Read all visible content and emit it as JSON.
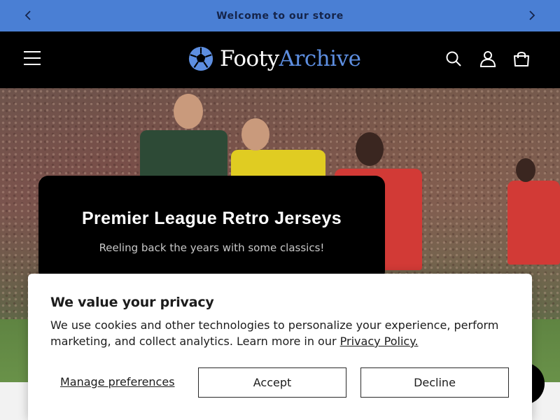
{
  "announcement": {
    "text": "Welcome to our store",
    "prev_icon": "chevron-left-icon",
    "next_icon": "chevron-right-icon",
    "background": "#4a7fd4"
  },
  "header": {
    "logo_primary": "Footy",
    "logo_accent": "Archive",
    "accent_color": "#5d8ee0",
    "icons": [
      "menu-icon",
      "search-icon",
      "account-icon",
      "cart-icon"
    ]
  },
  "hero": {
    "title": "Premier League Retro Jerseys",
    "subtitle": "Reeling back the years with some classics!"
  },
  "cookie_banner": {
    "title": "We value your privacy",
    "body": "We use cookies and other technologies to personalize your experience, perform marketing, and collect analytics. Learn more in our",
    "policy_link": "Privacy Policy.",
    "manage_label": "Manage preferences",
    "accept_label": "Accept",
    "decline_label": "Decline"
  }
}
